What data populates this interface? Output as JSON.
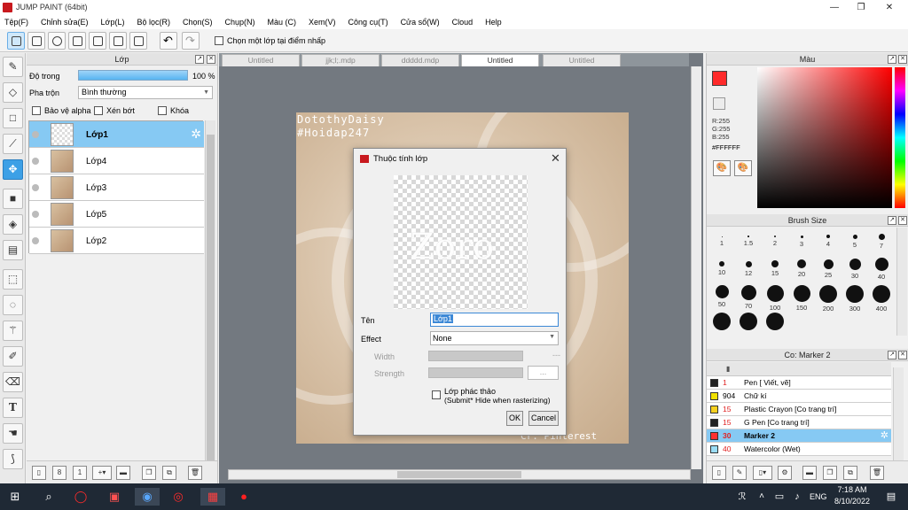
{
  "window": {
    "title": "JUMP PAINT (64bit)"
  },
  "menu": [
    "Tệp(F)",
    "Chỉnh sửa(E)",
    "Lớp(L)",
    "Bộ lọc(R)",
    "Chọn(S)",
    "Chụp(N)",
    "Màu (C)",
    "Xem(V)",
    "Công cụ(T)",
    "Cửa sổ(W)",
    "Cloud",
    "Help"
  ],
  "toolbar": {
    "pick_layer_label": "Chọn một lớp tại điểm nhấp"
  },
  "layer_panel": {
    "title": "Lớp",
    "opacity_label": "Độ trong",
    "opacity_value": "100 %",
    "opacity_fraction": 1.0,
    "blend_label": "Pha trộn",
    "blend_value": "Bình thường",
    "protect_alpha": "Bảo vệ alpha",
    "clipping": "Xén bớt",
    "lock": "Khóa",
    "layers": [
      {
        "name": "Lớp1",
        "selected": true
      },
      {
        "name": "Lớp4",
        "selected": false
      },
      {
        "name": "Lớp3",
        "selected": false
      },
      {
        "name": "Lớp5",
        "selected": false
      },
      {
        "name": "Lớp2",
        "selected": false
      }
    ]
  },
  "tabs": [
    "Untitled",
    "jjk;l;.mdp",
    "ddddd.mdp",
    "Untitled",
    "Untitled"
  ],
  "active_tab": 3,
  "canvas": {
    "watermark_line1": "DotothyDaisy",
    "watermark_line2": "#Hoidap247",
    "credit": "Cr: Pinterest",
    "preview_text": "Zoro"
  },
  "dialog": {
    "title": "Thuộc tính lớp",
    "name_label": "Tên",
    "name_value": "Lớp1",
    "effect_label": "Effect",
    "effect_value": "None",
    "width_label": "Width",
    "width_value": "---",
    "strength_label": "Strength",
    "strength_button": "...",
    "draft_label": "Lớp phác thảo",
    "draft_note": "(Submit* Hide when rasterizing)",
    "ok": "OK",
    "cancel": "Cancel"
  },
  "color_panel": {
    "title": "Màu",
    "r": "R:255",
    "g": "G:255",
    "b": "B:255",
    "hex": "#FFFFFF",
    "foreground": "#ff2a2a"
  },
  "brush_panel": {
    "title": "Brush Size",
    "sizes": [
      "1",
      "1.5",
      "2",
      "3",
      "4",
      "5",
      "7",
      "10",
      "12",
      "15",
      "20",
      "25",
      "30",
      "40",
      "50",
      "70",
      "100",
      "150",
      "200",
      "300",
      "400",
      "",
      "",
      ""
    ]
  },
  "tool_panel": {
    "title": "Co: Marker 2",
    "items": [
      {
        "size": "1",
        "name": "Pen [ Viết, vẽ]",
        "color": "#222222",
        "selected": false
      },
      {
        "size": "904",
        "name": "Chữ kí",
        "color": "#f0e000",
        "selected": false
      },
      {
        "size": "15",
        "name": "Plastic Crayon [Co trang trí]",
        "color": "#f5d020",
        "selected": false
      },
      {
        "size": "15",
        "name": "G Pen [Co trang trí]",
        "color": "#222222",
        "selected": false
      },
      {
        "size": "30",
        "name": "Marker 2",
        "color": "#ff3030",
        "selected": true
      },
      {
        "size": "40",
        "name": "Watercolor (Wet)",
        "color": "#9adcf5",
        "selected": false
      }
    ]
  },
  "taskbar": {
    "lang": "ENG",
    "time": "7:18 AM",
    "date": "8/10/2022"
  }
}
